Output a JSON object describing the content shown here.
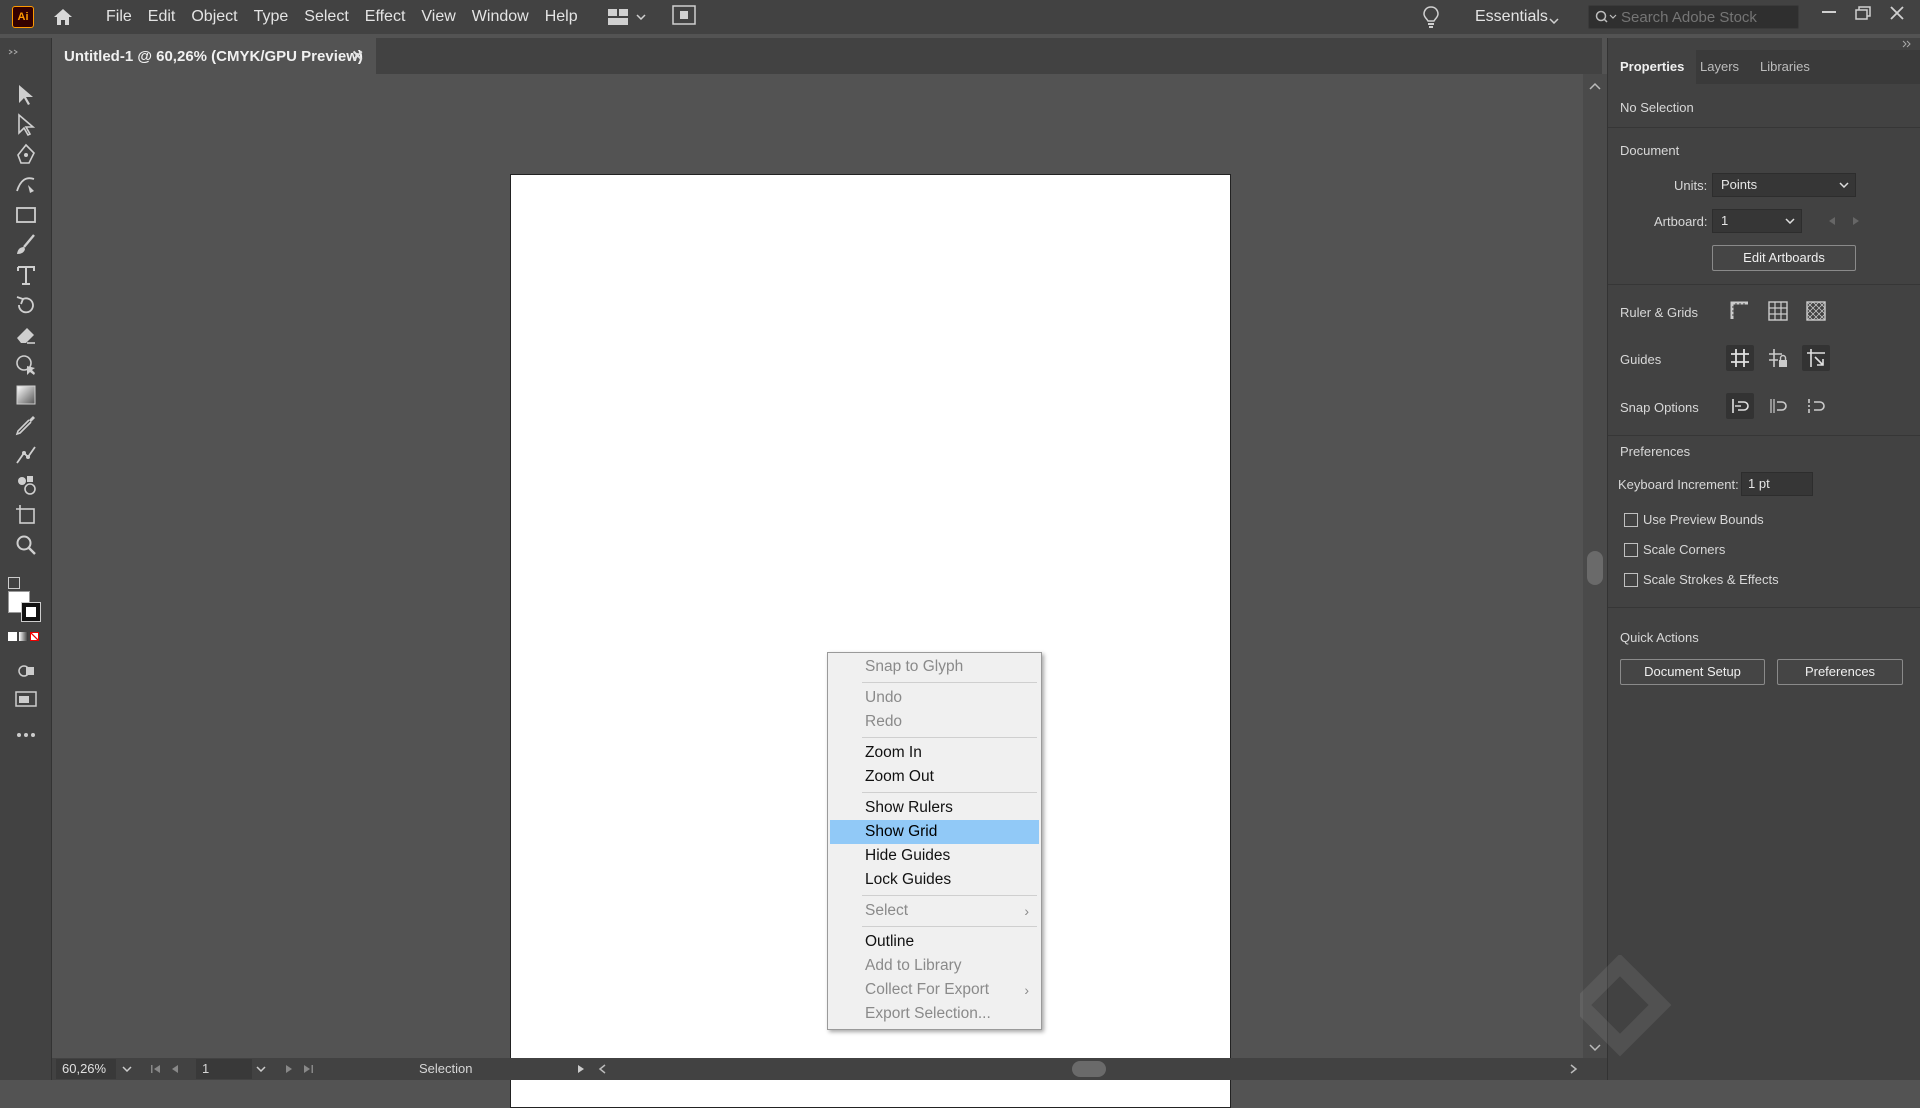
{
  "app": {
    "logo_text": "Ai",
    "accent": "#ff9a00"
  },
  "menu": [
    "File",
    "Edit",
    "Object",
    "Type",
    "Select",
    "Effect",
    "View",
    "Window",
    "Help"
  ],
  "workspace": {
    "label": "Essentials"
  },
  "search": {
    "placeholder": "Search Adobe Stock"
  },
  "document_tab": {
    "title": "Untitled-1 @ 60,26% (CMYK/GPU Preview)",
    "close": "✕"
  },
  "tools": [
    "selection-tool-icon",
    "direct-selection-tool-icon",
    "pen-tool-icon",
    "curvature-tool-icon",
    "rectangle-tool-icon",
    "paintbrush-tool-icon",
    "type-tool-icon",
    "rotate-tool-icon",
    "eraser-tool-icon",
    "shape-builder-tool-icon",
    "gradient-tool-icon",
    "eyedropper-tool-icon",
    "puppet-warp-tool-icon",
    "symbol-sprayer-tool-icon",
    "artboard-tool-icon",
    "zoom-tool-icon"
  ],
  "context_menu": [
    {
      "label": "Snap to Glyph",
      "disabled": true
    },
    {
      "sep": true
    },
    {
      "label": "Undo",
      "disabled": true
    },
    {
      "label": "Redo",
      "disabled": true
    },
    {
      "sep": true
    },
    {
      "label": "Zoom In",
      "disabled": false
    },
    {
      "label": "Zoom Out",
      "disabled": false
    },
    {
      "sep": true
    },
    {
      "label": "Show Rulers",
      "disabled": false
    },
    {
      "label": "Show Grid",
      "disabled": false,
      "highlight": true
    },
    {
      "label": "Hide Guides",
      "disabled": false
    },
    {
      "label": "Lock Guides",
      "disabled": false
    },
    {
      "sep": true
    },
    {
      "label": "Select",
      "disabled": true,
      "submenu": true
    },
    {
      "sep": true
    },
    {
      "label": "Outline",
      "disabled": false
    },
    {
      "label": "Add to Library",
      "disabled": true
    },
    {
      "label": "Collect For Export",
      "disabled": true,
      "submenu": true
    },
    {
      "label": "Export Selection...",
      "disabled": true
    }
  ],
  "status": {
    "zoom": "60,26%",
    "artboard": "1",
    "tool": "Selection"
  },
  "panel": {
    "tabs": [
      "Properties",
      "Layers",
      "Libraries"
    ],
    "selection": "No Selection",
    "document_heading": "Document",
    "units_label": "Units:",
    "units_value": "Points",
    "artboard_label": "Artboard:",
    "artboard_value": "1",
    "edit_artboards": "Edit Artboards",
    "rulers_grids": "Ruler & Grids",
    "guides": "Guides",
    "snap_options": "Snap Options",
    "preferences_heading": "Preferences",
    "keyboard_increment_label": "Keyboard Increment:",
    "keyboard_increment_value": "1 pt",
    "use_preview_bounds": "Use Preview Bounds",
    "scale_corners": "Scale Corners",
    "scale_strokes": "Scale Strokes & Effects",
    "quick_actions": "Quick Actions",
    "document_setup": "Document Setup",
    "preferences_btn": "Preferences"
  }
}
